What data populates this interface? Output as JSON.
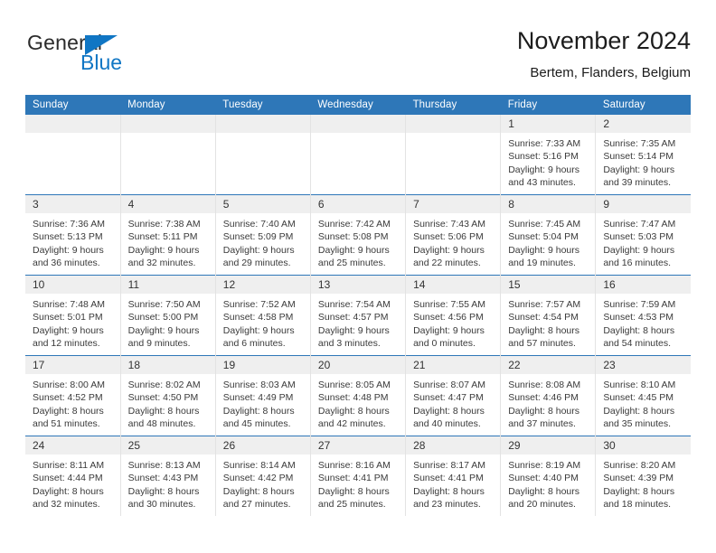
{
  "brand": {
    "word_one": "General",
    "word_two": "Blue",
    "triangle_icon": "triangle-icon"
  },
  "header": {
    "title": "November 2024",
    "subtitle": "Bertem, Flanders, Belgium"
  },
  "colors": {
    "header_blue": "#2e77b8",
    "daynum_band": "#efefef",
    "brand_blue": "#1076c4",
    "text": "#3a3a3a"
  },
  "labels": {
    "sunrise_prefix": "Sunrise:",
    "sunset_prefix": "Sunset:",
    "daylight_prefix": "Daylight:"
  },
  "weekday_headers": [
    "Sunday",
    "Monday",
    "Tuesday",
    "Wednesday",
    "Thursday",
    "Friday",
    "Saturday"
  ],
  "weeks": [
    [
      {
        "day": "",
        "sunrise": "",
        "sunset": "",
        "daylight": "",
        "empty": true
      },
      {
        "day": "",
        "sunrise": "",
        "sunset": "",
        "daylight": "",
        "empty": true
      },
      {
        "day": "",
        "sunrise": "",
        "sunset": "",
        "daylight": "",
        "empty": true
      },
      {
        "day": "",
        "sunrise": "",
        "sunset": "",
        "daylight": "",
        "empty": true
      },
      {
        "day": "",
        "sunrise": "",
        "sunset": "",
        "daylight": "",
        "empty": true
      },
      {
        "day": "1",
        "sunrise": "Sunrise: 7:33 AM",
        "sunset": "Sunset: 5:16 PM",
        "daylight": "Daylight: 9 hours and 43 minutes.",
        "empty": false
      },
      {
        "day": "2",
        "sunrise": "Sunrise: 7:35 AM",
        "sunset": "Sunset: 5:14 PM",
        "daylight": "Daylight: 9 hours and 39 minutes.",
        "empty": false
      }
    ],
    [
      {
        "day": "3",
        "sunrise": "Sunrise: 7:36 AM",
        "sunset": "Sunset: 5:13 PM",
        "daylight": "Daylight: 9 hours and 36 minutes.",
        "empty": false
      },
      {
        "day": "4",
        "sunrise": "Sunrise: 7:38 AM",
        "sunset": "Sunset: 5:11 PM",
        "daylight": "Daylight: 9 hours and 32 minutes.",
        "empty": false
      },
      {
        "day": "5",
        "sunrise": "Sunrise: 7:40 AM",
        "sunset": "Sunset: 5:09 PM",
        "daylight": "Daylight: 9 hours and 29 minutes.",
        "empty": false
      },
      {
        "day": "6",
        "sunrise": "Sunrise: 7:42 AM",
        "sunset": "Sunset: 5:08 PM",
        "daylight": "Daylight: 9 hours and 25 minutes.",
        "empty": false
      },
      {
        "day": "7",
        "sunrise": "Sunrise: 7:43 AM",
        "sunset": "Sunset: 5:06 PM",
        "daylight": "Daylight: 9 hours and 22 minutes.",
        "empty": false
      },
      {
        "day": "8",
        "sunrise": "Sunrise: 7:45 AM",
        "sunset": "Sunset: 5:04 PM",
        "daylight": "Daylight: 9 hours and 19 minutes.",
        "empty": false
      },
      {
        "day": "9",
        "sunrise": "Sunrise: 7:47 AM",
        "sunset": "Sunset: 5:03 PM",
        "daylight": "Daylight: 9 hours and 16 minutes.",
        "empty": false
      }
    ],
    [
      {
        "day": "10",
        "sunrise": "Sunrise: 7:48 AM",
        "sunset": "Sunset: 5:01 PM",
        "daylight": "Daylight: 9 hours and 12 minutes.",
        "empty": false
      },
      {
        "day": "11",
        "sunrise": "Sunrise: 7:50 AM",
        "sunset": "Sunset: 5:00 PM",
        "daylight": "Daylight: 9 hours and 9 minutes.",
        "empty": false
      },
      {
        "day": "12",
        "sunrise": "Sunrise: 7:52 AM",
        "sunset": "Sunset: 4:58 PM",
        "daylight": "Daylight: 9 hours and 6 minutes.",
        "empty": false
      },
      {
        "day": "13",
        "sunrise": "Sunrise: 7:54 AM",
        "sunset": "Sunset: 4:57 PM",
        "daylight": "Daylight: 9 hours and 3 minutes.",
        "empty": false
      },
      {
        "day": "14",
        "sunrise": "Sunrise: 7:55 AM",
        "sunset": "Sunset: 4:56 PM",
        "daylight": "Daylight: 9 hours and 0 minutes.",
        "empty": false
      },
      {
        "day": "15",
        "sunrise": "Sunrise: 7:57 AM",
        "sunset": "Sunset: 4:54 PM",
        "daylight": "Daylight: 8 hours and 57 minutes.",
        "empty": false
      },
      {
        "day": "16",
        "sunrise": "Sunrise: 7:59 AM",
        "sunset": "Sunset: 4:53 PM",
        "daylight": "Daylight: 8 hours and 54 minutes.",
        "empty": false
      }
    ],
    [
      {
        "day": "17",
        "sunrise": "Sunrise: 8:00 AM",
        "sunset": "Sunset: 4:52 PM",
        "daylight": "Daylight: 8 hours and 51 minutes.",
        "empty": false
      },
      {
        "day": "18",
        "sunrise": "Sunrise: 8:02 AM",
        "sunset": "Sunset: 4:50 PM",
        "daylight": "Daylight: 8 hours and 48 minutes.",
        "empty": false
      },
      {
        "day": "19",
        "sunrise": "Sunrise: 8:03 AM",
        "sunset": "Sunset: 4:49 PM",
        "daylight": "Daylight: 8 hours and 45 minutes.",
        "empty": false
      },
      {
        "day": "20",
        "sunrise": "Sunrise: 8:05 AM",
        "sunset": "Sunset: 4:48 PM",
        "daylight": "Daylight: 8 hours and 42 minutes.",
        "empty": false
      },
      {
        "day": "21",
        "sunrise": "Sunrise: 8:07 AM",
        "sunset": "Sunset: 4:47 PM",
        "daylight": "Daylight: 8 hours and 40 minutes.",
        "empty": false
      },
      {
        "day": "22",
        "sunrise": "Sunrise: 8:08 AM",
        "sunset": "Sunset: 4:46 PM",
        "daylight": "Daylight: 8 hours and 37 minutes.",
        "empty": false
      },
      {
        "day": "23",
        "sunrise": "Sunrise: 8:10 AM",
        "sunset": "Sunset: 4:45 PM",
        "daylight": "Daylight: 8 hours and 35 minutes.",
        "empty": false
      }
    ],
    [
      {
        "day": "24",
        "sunrise": "Sunrise: 8:11 AM",
        "sunset": "Sunset: 4:44 PM",
        "daylight": "Daylight: 8 hours and 32 minutes.",
        "empty": false
      },
      {
        "day": "25",
        "sunrise": "Sunrise: 8:13 AM",
        "sunset": "Sunset: 4:43 PM",
        "daylight": "Daylight: 8 hours and 30 minutes.",
        "empty": false
      },
      {
        "day": "26",
        "sunrise": "Sunrise: 8:14 AM",
        "sunset": "Sunset: 4:42 PM",
        "daylight": "Daylight: 8 hours and 27 minutes.",
        "empty": false
      },
      {
        "day": "27",
        "sunrise": "Sunrise: 8:16 AM",
        "sunset": "Sunset: 4:41 PM",
        "daylight": "Daylight: 8 hours and 25 minutes.",
        "empty": false
      },
      {
        "day": "28",
        "sunrise": "Sunrise: 8:17 AM",
        "sunset": "Sunset: 4:41 PM",
        "daylight": "Daylight: 8 hours and 23 minutes.",
        "empty": false
      },
      {
        "day": "29",
        "sunrise": "Sunrise: 8:19 AM",
        "sunset": "Sunset: 4:40 PM",
        "daylight": "Daylight: 8 hours and 20 minutes.",
        "empty": false
      },
      {
        "day": "30",
        "sunrise": "Sunrise: 8:20 AM",
        "sunset": "Sunset: 4:39 PM",
        "daylight": "Daylight: 8 hours and 18 minutes.",
        "empty": false
      }
    ]
  ]
}
